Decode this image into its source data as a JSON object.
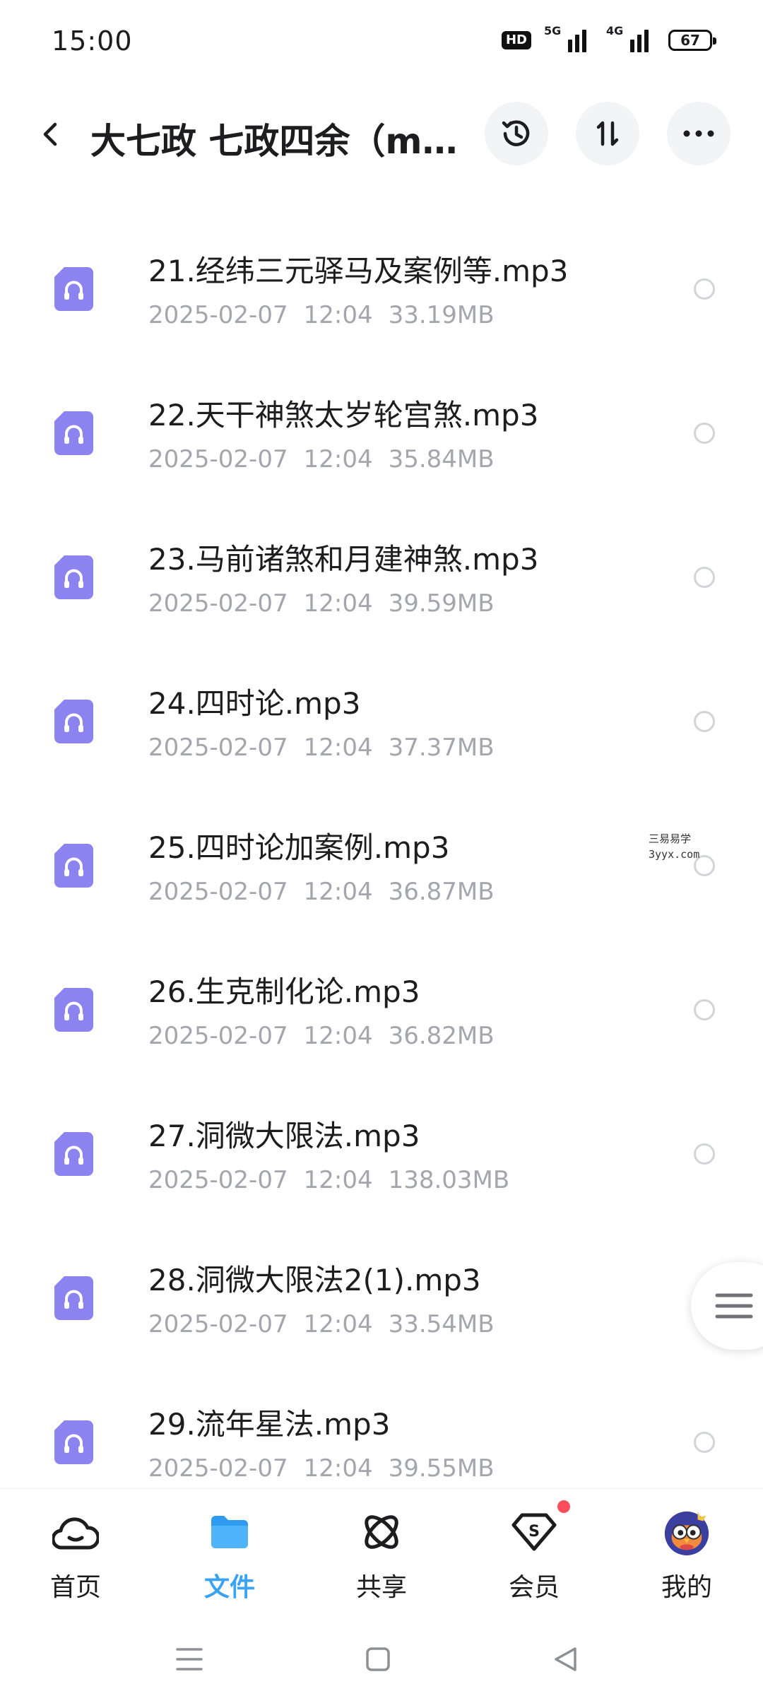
{
  "status_bar": {
    "time": "15:00",
    "hd_badge": "HD",
    "signal_1_label": "5G",
    "signal_2_label": "4G",
    "battery": "67"
  },
  "header": {
    "title": "大七政 七政四余（m...",
    "icons": [
      "back-icon",
      "history-icon",
      "sort-icon",
      "more-icon"
    ]
  },
  "files": [
    {
      "name": "21.经纬三元驿马及案例等.mp3",
      "date": "2025-02-07",
      "time": "12:04",
      "size": "33.19MB"
    },
    {
      "name": "22.天干神煞太岁轮宫煞.mp3",
      "date": "2025-02-07",
      "time": "12:04",
      "size": "35.84MB"
    },
    {
      "name": "23.马前诸煞和月建神煞.mp3",
      "date": "2025-02-07",
      "time": "12:04",
      "size": "39.59MB"
    },
    {
      "name": "24.四时论.mp3",
      "date": "2025-02-07",
      "time": "12:04",
      "size": "37.37MB"
    },
    {
      "name": "25.四时论加案例.mp3",
      "date": "2025-02-07",
      "time": "12:04",
      "size": "36.87MB"
    },
    {
      "name": "26.生克制化论.mp3",
      "date": "2025-02-07",
      "time": "12:04",
      "size": "36.82MB"
    },
    {
      "name": "27.洞微大限法.mp3",
      "date": "2025-02-07",
      "time": "12:04",
      "size": "138.03MB"
    },
    {
      "name": "28.洞微大限法2(1).mp3",
      "date": "2025-02-07",
      "time": "12:04",
      "size": "33.54MB"
    },
    {
      "name": "29.流年星法.mp3",
      "date": "2025-02-07",
      "time": "12:04",
      "size": "39.55MB"
    }
  ],
  "watermark": {
    "line1": "三易易学",
    "line2": "3yyx.com"
  },
  "bottom_nav": {
    "items": [
      {
        "label": "首页",
        "icon": "home-cloud-icon"
      },
      {
        "label": "文件",
        "icon": "folder-icon"
      },
      {
        "label": "共享",
        "icon": "share-atom-icon"
      },
      {
        "label": "会员",
        "icon": "vip-diamond-icon"
      },
      {
        "label": "我的",
        "icon": "avatar-owl-icon"
      }
    ],
    "active_index": 1
  },
  "colors": {
    "accent": "#3aa3f5",
    "file_icon": "#8b84f0",
    "meta_text": "#a3a6ad",
    "notification": "#ff4d5e"
  }
}
